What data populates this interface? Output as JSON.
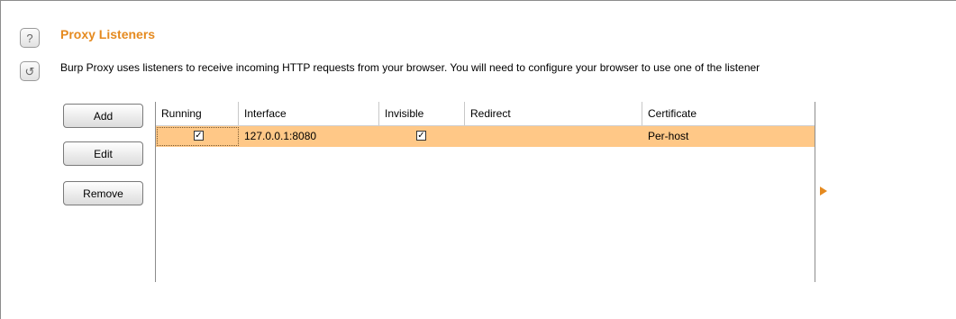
{
  "section": {
    "title": "Proxy Listeners",
    "description": "Burp Proxy uses listeners to receive incoming HTTP requests from your browser. You will need to configure your browser to use one of the listener"
  },
  "side_icons": {
    "help": "?",
    "restore": "↺"
  },
  "buttons": {
    "add": "Add",
    "edit": "Edit",
    "remove": "Remove"
  },
  "table": {
    "columns": [
      "Running",
      "Interface",
      "Invisible",
      "Redirect",
      "Certificate"
    ],
    "rows": [
      {
        "running": true,
        "running_mark": "✓",
        "interface": "127.0.0.1:8080",
        "invisible": true,
        "invisible_mark": "✓",
        "redirect": "",
        "certificate": "Per-host"
      }
    ]
  },
  "colors": {
    "title": "#e58a1f",
    "selected_row": "#ffc887"
  }
}
